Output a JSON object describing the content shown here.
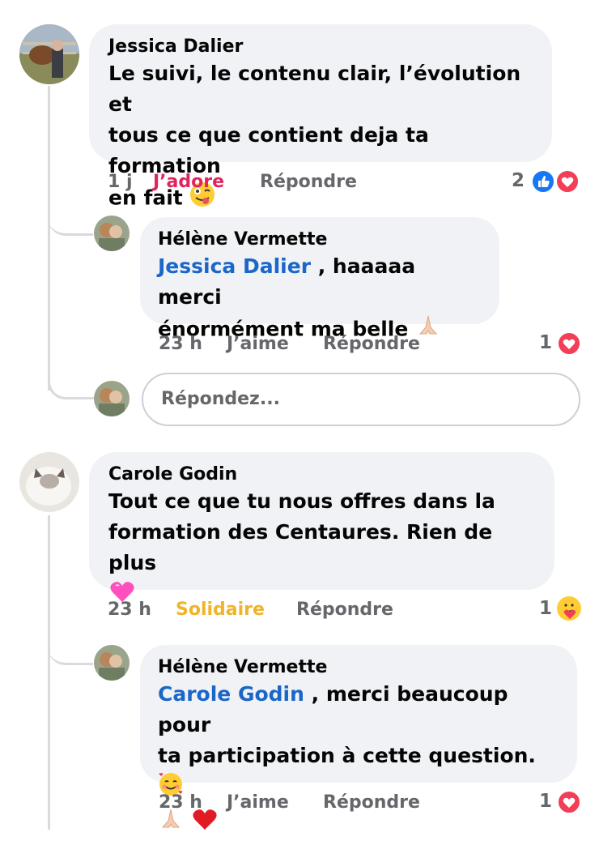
{
  "comments": [
    {
      "author": "Jessica Dalier",
      "lines": [
        "Le suivi, le contenu clair, l’évolution et",
        "tous ce que contient deja ta formation",
        "en fait"
      ],
      "time": "1 j",
      "reaction_label": "J’adore",
      "reaction_color": "#e0245e",
      "reply_label": "Répondre",
      "reaction_count": "2",
      "reactions": [
        "like-icon",
        "love-icon"
      ],
      "trailing_emoji": "winking-face-tongue-icon"
    },
    {
      "author": "Carole Godin",
      "lines": [
        "Tout ce que tu nous offres dans la",
        "formation des Centaures. Rien de plus"
      ],
      "time": "23 h",
      "reaction_label": "Solidaire",
      "reaction_color": "#f0b429",
      "reply_label": "Répondre",
      "reaction_count": "1",
      "reactions": [
        "care-icon"
      ],
      "trailing_emoji": "pink-heart-icon"
    }
  ],
  "replies": [
    {
      "author": "Hélène Vermette",
      "mention": "Jessica Dalier",
      "text_first": " , haaaaa merci",
      "text_second": "énormément ma belle",
      "time": "23 h",
      "like_label": "J’aime",
      "reply_label": "Répondre",
      "reaction_count": "1",
      "reactions": [
        "love-icon"
      ]
    },
    {
      "author": "Hélène Vermette",
      "mention": "Carole Godin",
      "text_first": " , merci beaucoup pour",
      "text_second": "ta participation à cette question.",
      "time": "23 h",
      "like_label": "J’aime",
      "reply_label": "Répondre",
      "reaction_count": "1",
      "reactions": [
        "love-icon"
      ]
    }
  ],
  "reply_input": {
    "placeholder": "Répondez..."
  },
  "colors": {
    "bubble": "#f0f2f5",
    "mention": "#1b66c9",
    "like_blue": "#1877f2",
    "love_red": "#f33e58"
  }
}
